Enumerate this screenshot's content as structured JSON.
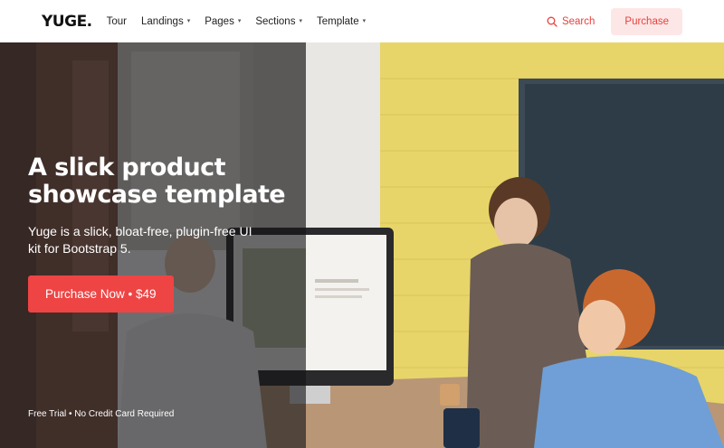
{
  "nav": {
    "brand": "YUGE.",
    "items": [
      {
        "label": "Tour",
        "dropdown": false
      },
      {
        "label": "Landings",
        "dropdown": true
      },
      {
        "label": "Pages",
        "dropdown": true
      },
      {
        "label": "Sections",
        "dropdown": true
      },
      {
        "label": "Template",
        "dropdown": true
      }
    ],
    "search_label": "Search",
    "purchase_label": "Purchase",
    "search_icon": "search-icon",
    "caret_icon": "caret-down-icon"
  },
  "hero": {
    "title": "A slick product showcase template",
    "subtitle": "Yuge is a slick, bloat-free, plugin-free UI kit for Bootstrap 5.",
    "cta_label": "Purchase Now • $49",
    "fineprint": "Free Trial • No Credit Card Required"
  },
  "colors": {
    "accent": "#ef4444",
    "accent_soft": "#fde7e6"
  }
}
